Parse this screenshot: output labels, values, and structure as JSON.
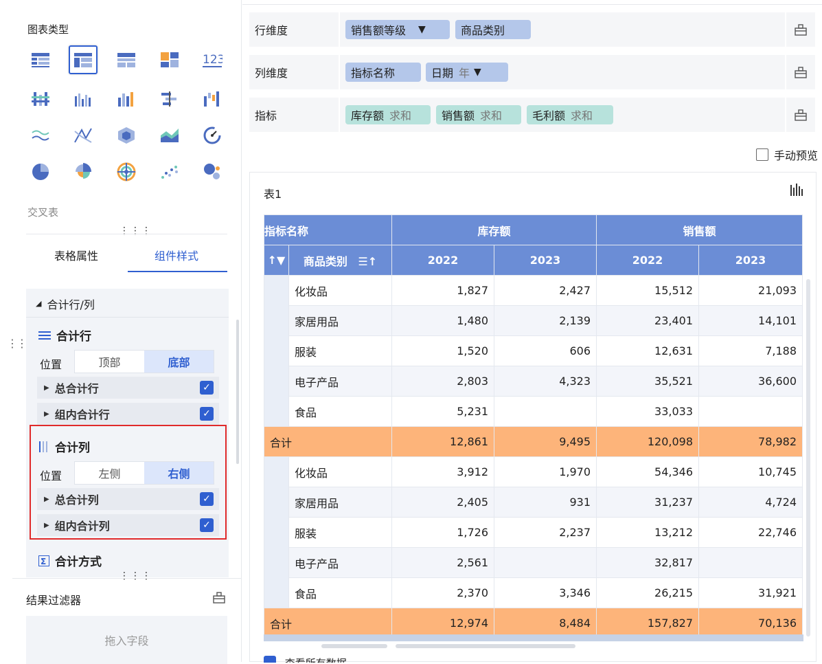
{
  "left": {
    "chart_type_title": "图表类型",
    "chart_type_selected": "交叉表",
    "chart_icons": [
      "table",
      "cross-table",
      "group-table",
      "block",
      "kpi",
      "grouped-bar",
      "column",
      "multi-column",
      "gantt",
      "waterfall",
      "line",
      "radar",
      "polygon",
      "area",
      "gauge",
      "pie",
      "rose",
      "concentric",
      "scatter",
      "bubble"
    ],
    "tabs": [
      "表格属性",
      "组件样式"
    ],
    "active_tab": "组件样式",
    "section_header": "合计行/列",
    "total_row": {
      "title": "合计行",
      "pos_label": "位置",
      "options": [
        "顶部",
        "底部"
      ],
      "selected": "底部",
      "items": [
        {
          "label": "总合计行",
          "checked": true
        },
        {
          "label": "组内合计行",
          "checked": true
        }
      ]
    },
    "total_col": {
      "title": "合计列",
      "pos_label": "位置",
      "options": [
        "左侧",
        "右侧"
      ],
      "selected": "右侧",
      "items": [
        {
          "label": "总合计列",
          "checked": true
        },
        {
          "label": "组内合计列",
          "checked": true
        }
      ]
    },
    "agg_method": "合计方式",
    "filter_title": "结果过滤器",
    "filter_placeholder": "拖入字段"
  },
  "right": {
    "row_dim_label": "行维度",
    "row_fields": [
      {
        "name": "销售额等级",
        "filter": true
      },
      {
        "name": "商品类别"
      }
    ],
    "col_dim_label": "列维度",
    "col_fields": [
      {
        "name": "指标名称"
      },
      {
        "name": "日期",
        "sub": "年",
        "filter": true
      }
    ],
    "metric_label": "指标",
    "metrics": [
      {
        "name": "库存额",
        "agg": "求和"
      },
      {
        "name": "销售额",
        "agg": "求和"
      },
      {
        "name": "毛利额",
        "agg": "求和"
      }
    ],
    "manual_preview": "手动预览",
    "table_title": "表1",
    "header_metric_name": "指标名称",
    "header_cat": "商品类别",
    "metric_headers": [
      "库存额",
      "销售额"
    ],
    "years": [
      "2022",
      "2023",
      "2022",
      "2023"
    ],
    "groups": [
      {
        "rows": [
          {
            "cat": "化妆品",
            "vals": [
              "1,827",
              "2,427",
              "15,512",
              "21,093"
            ]
          },
          {
            "cat": "家居用品",
            "vals": [
              "1,480",
              "2,139",
              "23,401",
              "14,101"
            ]
          },
          {
            "cat": "服装",
            "vals": [
              "1,520",
              "606",
              "12,631",
              "7,188"
            ]
          },
          {
            "cat": "电子产品",
            "vals": [
              "2,803",
              "4,323",
              "35,521",
              "36,600"
            ]
          },
          {
            "cat": "食品",
            "vals": [
              "5,231",
              "",
              "33,033",
              ""
            ]
          }
        ],
        "total": {
          "cat": "合计",
          "vals": [
            "12,861",
            "9,495",
            "120,098",
            "78,982"
          ]
        }
      },
      {
        "rows": [
          {
            "cat": "化妆品",
            "vals": [
              "3,912",
              "1,970",
              "54,346",
              "10,745"
            ]
          },
          {
            "cat": "家居用品",
            "vals": [
              "2,405",
              "931",
              "31,237",
              "4,724"
            ]
          },
          {
            "cat": "服装",
            "vals": [
              "1,726",
              "2,237",
              "13,212",
              "22,746"
            ]
          },
          {
            "cat": "电子产品",
            "vals": [
              "2,561",
              "",
              "32,817",
              ""
            ]
          },
          {
            "cat": "食品",
            "vals": [
              "2,370",
              "3,346",
              "26,215",
              "31,921"
            ]
          }
        ],
        "total": {
          "cat": "合计",
          "vals": [
            "12,974",
            "8,484",
            "157,827",
            "70,136"
          ]
        }
      }
    ],
    "bottom_peek": "查看所有数据"
  }
}
